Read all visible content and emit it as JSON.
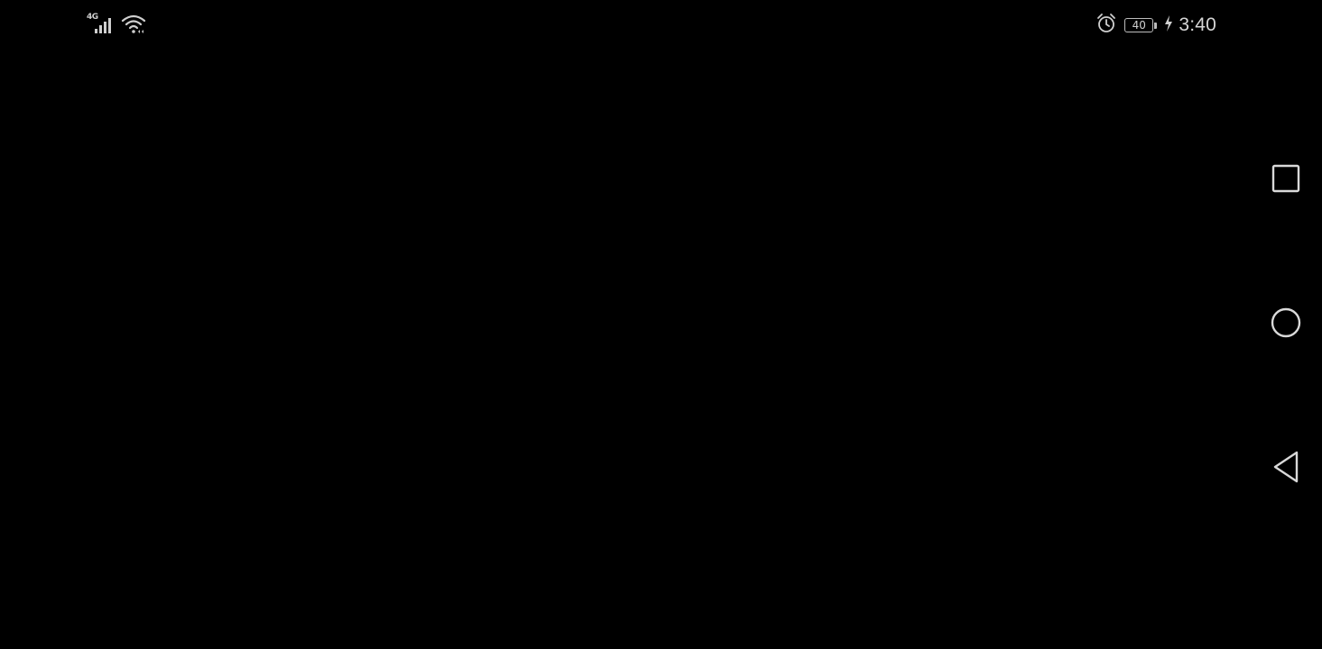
{
  "status_bar": {
    "network_type": "4G",
    "time": "3:40",
    "battery_level": "40",
    "charging": true,
    "icons": {
      "signal": "cellular-signal-icon",
      "wifi": "wifi-icon",
      "alarm": "alarm-clock-icon",
      "battery": "battery-icon",
      "charging": "charging-bolt-icon"
    }
  },
  "navigation_bar": {
    "buttons": [
      {
        "name": "recents",
        "icon": "square-icon"
      },
      {
        "name": "home",
        "icon": "circle-icon"
      },
      {
        "name": "back",
        "icon": "triangle-back-icon"
      }
    ]
  },
  "colors": {
    "background": "#000000",
    "status_foreground": "#cfcfcf",
    "nav_icon": "#d9d9d9"
  }
}
